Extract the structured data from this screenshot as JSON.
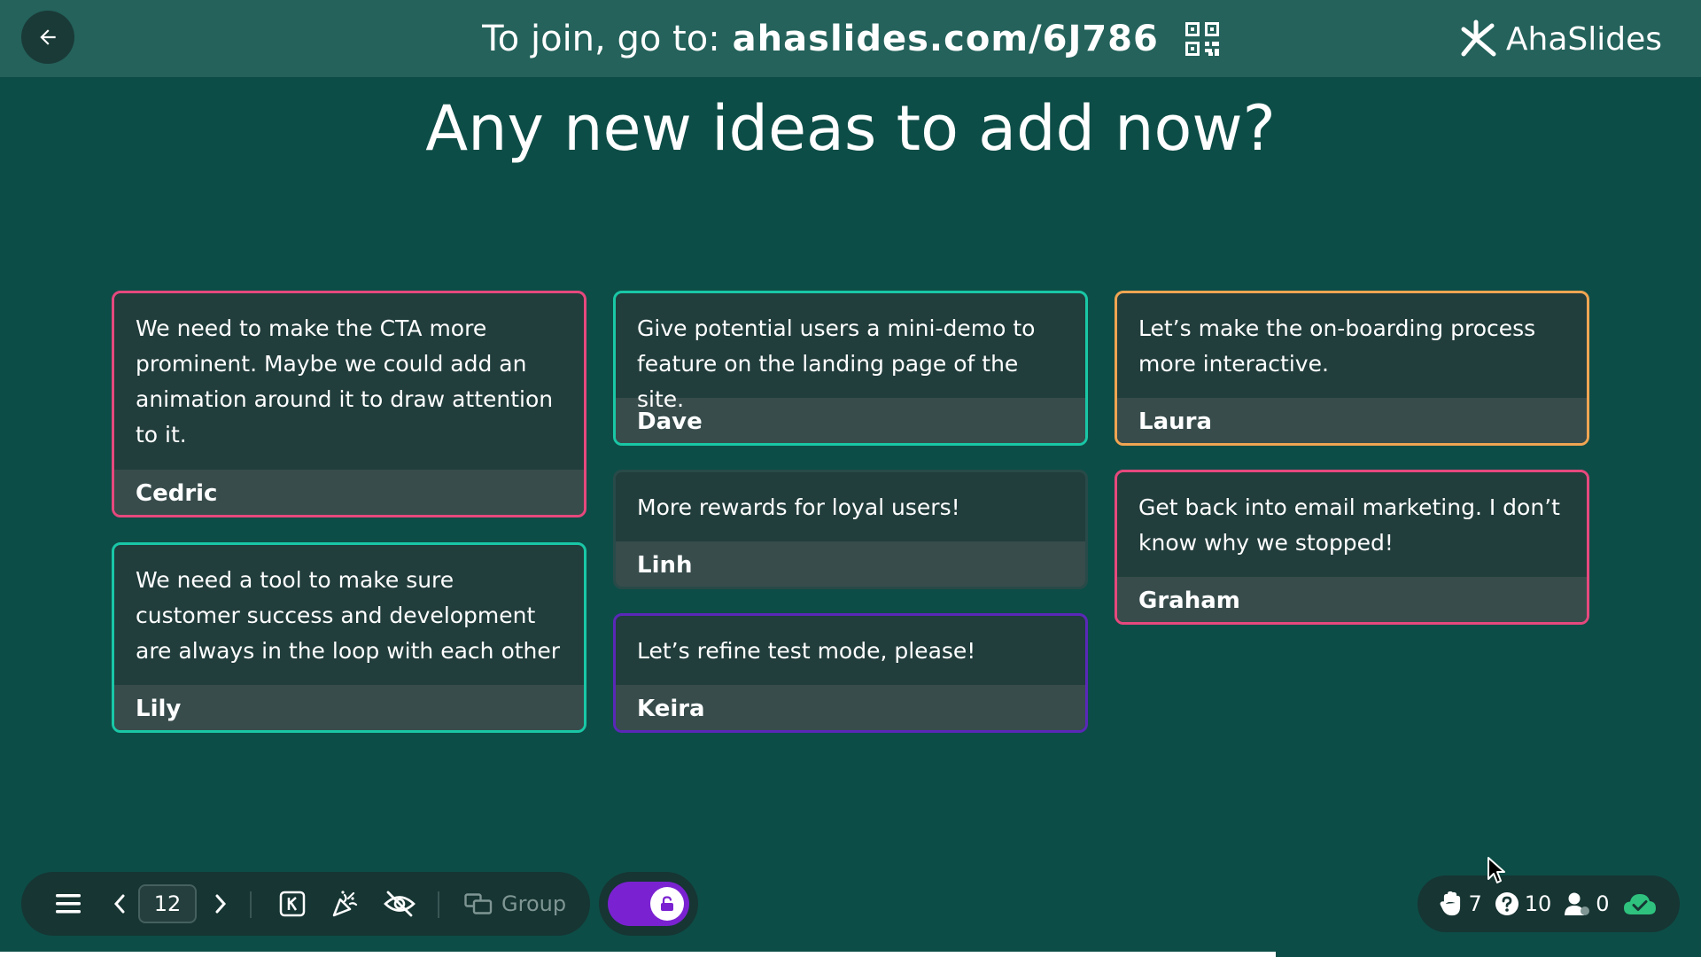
{
  "header": {
    "join_prefix": "To join, go to:",
    "join_url": "ahaslides.com/6J786",
    "brand_name": "AhaSlides"
  },
  "slide": {
    "title": "Any new ideas to add now?"
  },
  "cards": [
    {
      "text": "We need to make the CTA more prominent. Maybe we could add an animation around it to draw attention to it.",
      "author": "Cedric",
      "color": "#e6487d"
    },
    {
      "text": "We need a tool to make sure customer success and development are always in the loop with each other",
      "author": "Lily",
      "color": "#19c7a6"
    },
    {
      "text": "Give potential users a mini-demo to feature on the landing page of the site.",
      "author": "Dave",
      "color": "#19c7a6"
    },
    {
      "text": "More rewards for loyal users!",
      "author": "Linh",
      "color": "#284a48"
    },
    {
      "text": "Let’s refine test mode, please!",
      "author": "Keira",
      "color": "#5a28b8"
    },
    {
      "text": "Let’s make the on-boarding process more interactive.",
      "author": "Laura",
      "color": "#f0a552"
    },
    {
      "text": "Get back into email marketing. I don’t know why we stopped!",
      "author": "Graham",
      "color": "#e6487d"
    }
  ],
  "toolbar": {
    "page_number": "12",
    "group_label": "Group"
  },
  "stats": {
    "hands": "7",
    "questions": "10",
    "audience": "0"
  },
  "colors": {
    "background": "#0d4d47",
    "header": "#24625b",
    "accent_purple": "#7a22d1",
    "success_green": "#2ec27e"
  }
}
